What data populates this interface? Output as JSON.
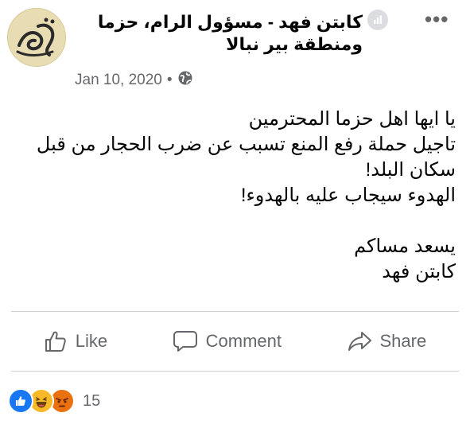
{
  "post": {
    "author": "كابتن فهد - مسؤول الرام، حزما ومنطقة بير نبالا",
    "date": "Jan 10, 2020",
    "separator": "•",
    "privacy_icon": "globe-icon",
    "body_lines": [
      "يا ايها اهل حزما المحترمين",
      "تاجيل حملة رفع المنع تسبب عن ضرب الحجار من قبل سكان البلد!",
      "الهدوء سيجاب عليه بالهدوء!"
    ],
    "signature_lines": [
      "يسعد مساكم",
      "كابتن فهد"
    ]
  },
  "actions": {
    "like_label": "Like",
    "comment_label": "Comment",
    "share_label": "Share"
  },
  "reactions": {
    "icons": [
      "like-icon",
      "haha-icon",
      "angry-icon"
    ],
    "count": "15"
  },
  "colors": {
    "secondary_text": "#65676b",
    "like_blue": "#1877f2",
    "haha_yellow": "#f7b928",
    "angry_orange": "#e9710f"
  }
}
